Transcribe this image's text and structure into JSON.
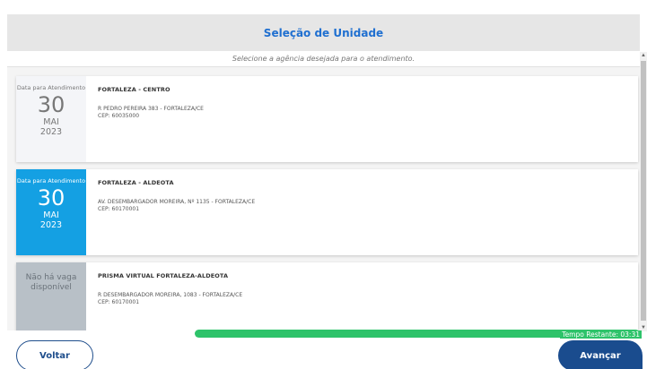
{
  "header": {
    "title": "Seleção de Unidade"
  },
  "subtitle": "Selecione a agência desejada para o atendimento.",
  "cards": [
    {
      "state": "plain",
      "date_label": "Data para Atendimento",
      "day": "30",
      "month": "MAI",
      "year": "2023",
      "name": "FORTALEZA - CENTRO",
      "address": "R PEDRO PEREIRA 383 - FORTALEZA/CE",
      "cep": "CEP: 60035000"
    },
    {
      "state": "selected",
      "date_label": "Data para Atendimento",
      "day": "30",
      "month": "MAI",
      "year": "2023",
      "name": "FORTALEZA - ALDEOTA",
      "address": "AV. DESEMBARGADOR MOREIRA, Nº 1135 - FORTALEZA/CE",
      "cep": "CEP: 60170001"
    },
    {
      "state": "unavailable",
      "unavailable_label": "Não há vaga disponível",
      "name": "PRISMA VIRTUAL FORTALEZA-ALDEOTA",
      "address": "R DESEMBARGADOR MOREIRA, 1083 - FORTALEZA/CE",
      "cep": "CEP: 60170001"
    }
  ],
  "timer": {
    "label": "Tempo Restante: 03:31"
  },
  "buttons": {
    "back": "Voltar",
    "next": "Avançar"
  },
  "colors": {
    "selected": "#14a0e3",
    "primary": "#1a4c8e",
    "progress": "#2ec36a",
    "title": "#1f6fd0"
  }
}
